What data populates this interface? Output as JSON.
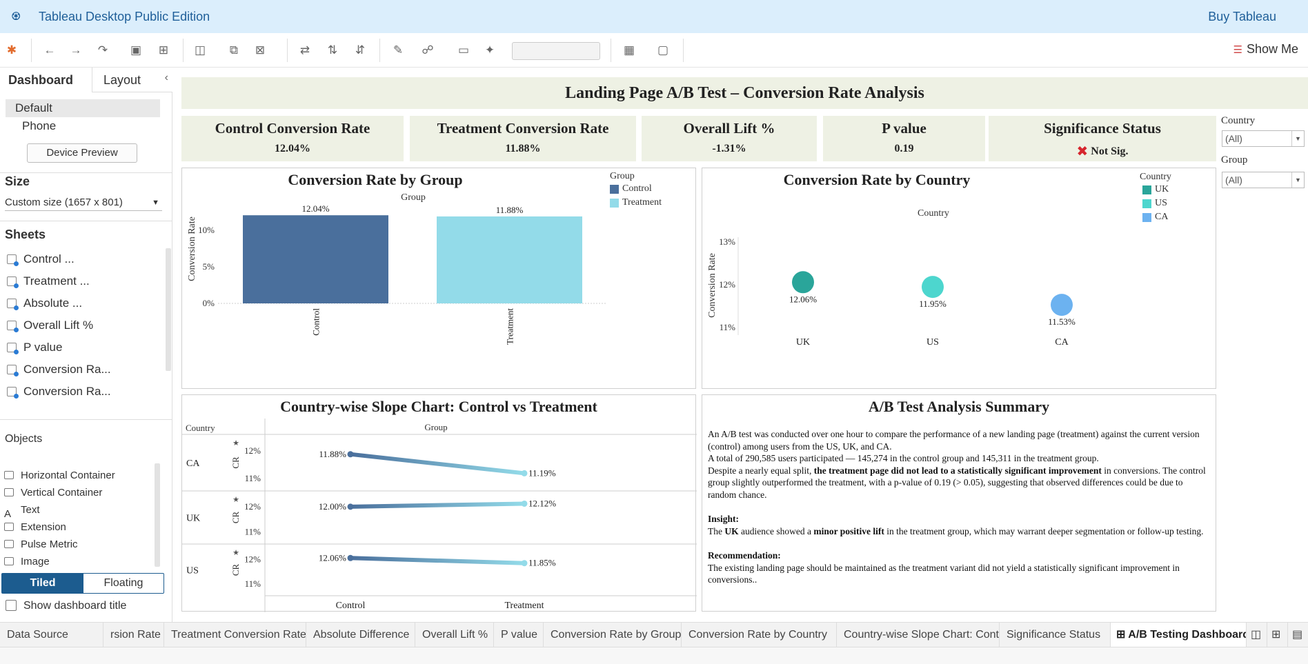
{
  "app": {
    "title": "Tableau Desktop Public Edition",
    "buy": "Buy Tableau",
    "show_me": "Show Me"
  },
  "left_panel": {
    "tab_dashboard": "Dashboard",
    "tab_layout": "Layout",
    "devices": [
      "Default",
      "Phone"
    ],
    "device_preview": "Device Preview",
    "size_label": "Size",
    "size_value": "Custom size (1657 x 801)",
    "sheets_label": "Sheets",
    "sheets": [
      "Control ...",
      "Treatment ...",
      "Absolute ...",
      "Overall Lift %",
      "P value",
      "Conversion Ra...",
      "Conversion Ra..."
    ],
    "objects_label": "Objects",
    "objects": [
      "Horizontal Container",
      "Vertical Container",
      "Text",
      "Extension",
      "Pulse Metric",
      "Image"
    ],
    "tiled": "Tiled",
    "floating": "Floating",
    "show_title": "Show dashboard title"
  },
  "dashboard": {
    "title": "Landing Page A/B Test – Conversion Rate Analysis",
    "kpis": [
      {
        "title": "Control Conversion Rate",
        "value": "12.04%"
      },
      {
        "title": "Treatment Conversion Rate",
        "value": "11.88%"
      },
      {
        "title": "Overall Lift %",
        "value": "-1.31%"
      },
      {
        "title": "P value",
        "value": "0.19"
      },
      {
        "title": "Significance Status",
        "value": "Not Sig."
      }
    ],
    "filters": [
      {
        "label": "Country",
        "value": "(All)"
      },
      {
        "label": "Group",
        "value": "(All)"
      }
    ],
    "summary": {
      "title": "A/B Test Analysis Summary",
      "p1a": "An A/B test was conducted over one hour to compare the performance of a new landing page (treatment) against the current version (control) among users from the US, UK, and CA.",
      "p1b": "A total of 290,585 users participated — 145,274 in the control group and 145,311 in the treatment group.",
      "p1c_pre": "Despite a nearly equal split, ",
      "p1c_bold": "the treatment page did not lead to a statistically significant improvement",
      "p1c_post": " in conversions. The control group slightly outperformed the treatment, with a p-value of 0.19 (> 0.05), suggesting that observed differences could be due to random chance.",
      "insight_label": "Insight:",
      "insight_pre": "The ",
      "insight_b1": "UK",
      "insight_mid": " audience showed a ",
      "insight_b2": "minor positive lift",
      "insight_post": " in the treatment group, which may warrant deeper segmentation or follow-up testing.",
      "rec_label": "Recommendation:",
      "rec_text": "The existing landing page should be maintained as the treatment variant did not yield a statistically significant improvement in conversions.."
    }
  },
  "chart_data": [
    {
      "type": "bar",
      "title": "Conversion Rate by Group",
      "xlabel": "Group",
      "ylabel": "Conversion Rate",
      "categories": [
        "Control",
        "Treatment"
      ],
      "values": [
        12.04,
        11.88
      ],
      "labels": [
        "12.04%",
        "11.88%"
      ],
      "yticks": [
        "0%",
        "5%",
        "10%"
      ],
      "ylim": [
        0,
        13
      ],
      "colors": [
        "#4a6f9c",
        "#93dbe9"
      ],
      "legend": {
        "title": "Group",
        "items": [
          "Control",
          "Treatment"
        ],
        "position": "top-right"
      }
    },
    {
      "type": "scatter",
      "title": "Conversion Rate by Country",
      "xlabel": "Country",
      "ylabel": "Conversion Rate",
      "categories": [
        "UK",
        "US",
        "CA"
      ],
      "values": [
        12.06,
        11.95,
        11.53
      ],
      "labels": [
        "12.06%",
        "11.95%",
        "11.53%"
      ],
      "yticks": [
        "11%",
        "12%",
        "13%"
      ],
      "ylim": [
        10.95,
        13.05
      ],
      "colors": [
        "#2aa59a",
        "#4dd6ce",
        "#6cb2f0"
      ],
      "legend": {
        "title": "Country",
        "items": [
          "UK",
          "US",
          "CA"
        ],
        "position": "top-right"
      }
    },
    {
      "type": "line",
      "title": "Country-wise Slope Chart: Control vs Treatment",
      "row_header": "Country",
      "column_header": "Group",
      "axis_label": "CR",
      "categories": [
        "Control",
        "Treatment"
      ],
      "yticks": [
        "11%",
        "12%"
      ],
      "ylim": [
        10.8,
        12.35
      ],
      "series": [
        {
          "name": "CA",
          "values": [
            11.88,
            11.19
          ],
          "labels": [
            "11.88%",
            "11.19%"
          ]
        },
        {
          "name": "UK",
          "values": [
            12.0,
            12.12
          ],
          "labels": [
            "12.00%",
            "12.12%"
          ]
        },
        {
          "name": "US",
          "values": [
            12.06,
            11.85
          ],
          "labels": [
            "12.06%",
            "11.85%"
          ]
        }
      ]
    }
  ],
  "sheet_tabs": [
    "Data Source",
    "rsion Rate",
    "Treatment Conversion Rate",
    "Absolute Difference",
    "Overall Lift %",
    "P value",
    "Conversion Rate by Group",
    "Conversion Rate by Country",
    "Country-wise Slope Chart: Contr...",
    "Significance Status",
    "A/B Testing Dashboard"
  ]
}
